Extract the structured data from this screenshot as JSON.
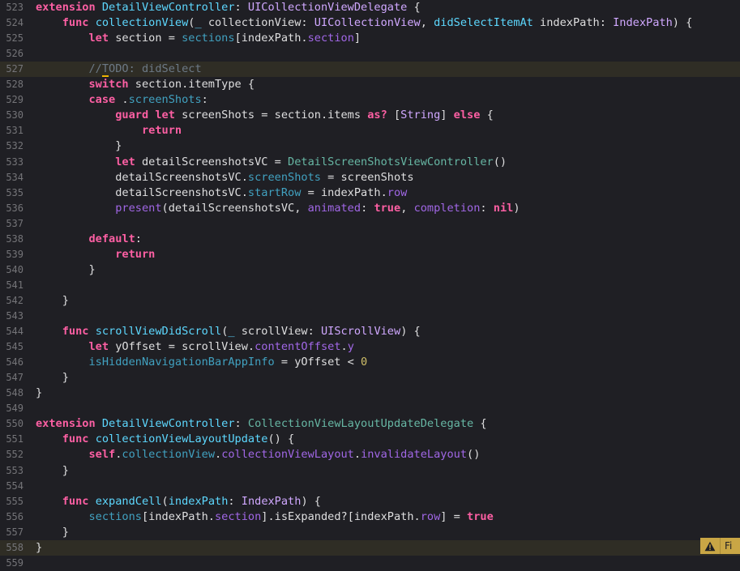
{
  "editor": {
    "highlight_lines": [
      "527",
      "558"
    ],
    "lines": [
      {
        "n": "523",
        "tokens": [
          [
            "kw",
            "extension"
          ],
          [
            "pl",
            " "
          ],
          [
            "pty",
            "DetailViewController"
          ],
          [
            "pl",
            ": "
          ],
          [
            "ty",
            "UICollectionViewDelegate"
          ],
          [
            "pl",
            " {"
          ]
        ]
      },
      {
        "n": "524",
        "tokens": [
          [
            "pl",
            "    "
          ],
          [
            "kw",
            "func"
          ],
          [
            "pl",
            " "
          ],
          [
            "pty",
            "collectionView"
          ],
          [
            "pl",
            "("
          ],
          [
            "pty",
            "_"
          ],
          [
            "pl",
            " collectionView: "
          ],
          [
            "ty",
            "UICollectionView"
          ],
          [
            "pl",
            ", "
          ],
          [
            "pty",
            "didSelectItemAt"
          ],
          [
            "pl",
            " indexPath: "
          ],
          [
            "ty",
            "IndexPath"
          ],
          [
            "pl",
            ") {"
          ]
        ]
      },
      {
        "n": "525",
        "tokens": [
          [
            "pl",
            "        "
          ],
          [
            "kw",
            "let"
          ],
          [
            "pl",
            " section = "
          ],
          [
            "proj",
            "sections"
          ],
          [
            "pl",
            "[indexPath."
          ],
          [
            "pf",
            "section"
          ],
          [
            "pl",
            "]"
          ]
        ]
      },
      {
        "n": "526",
        "tokens": []
      },
      {
        "n": "527",
        "tokens": [
          [
            "pl",
            "        "
          ],
          [
            "cm",
            "//"
          ],
          [
            "cm_warn",
            "T"
          ],
          [
            "cm",
            "ODO: didSelect"
          ]
        ]
      },
      {
        "n": "528",
        "tokens": [
          [
            "pl",
            "        "
          ],
          [
            "kw",
            "switch"
          ],
          [
            "pl",
            " section.itemType {"
          ]
        ]
      },
      {
        "n": "529",
        "tokens": [
          [
            "pl",
            "        "
          ],
          [
            "kw",
            "case"
          ],
          [
            "pl",
            " ."
          ],
          [
            "proj",
            "screenShots"
          ],
          [
            "pl",
            ":"
          ]
        ]
      },
      {
        "n": "530",
        "tokens": [
          [
            "pl",
            "            "
          ],
          [
            "kw",
            "guard"
          ],
          [
            "pl",
            " "
          ],
          [
            "kw",
            "let"
          ],
          [
            "pl",
            " screenShots = section.items "
          ],
          [
            "kw",
            "as?"
          ],
          [
            "pl",
            " ["
          ],
          [
            "ty",
            "String"
          ],
          [
            "pl",
            "] "
          ],
          [
            "kw",
            "else"
          ],
          [
            "pl",
            " {"
          ]
        ]
      },
      {
        "n": "531",
        "tokens": [
          [
            "pl",
            "                "
          ],
          [
            "kw",
            "return"
          ]
        ]
      },
      {
        "n": "532",
        "tokens": [
          [
            "pl",
            "            }"
          ]
        ]
      },
      {
        "n": "533",
        "tokens": [
          [
            "pl",
            "            "
          ],
          [
            "kw",
            "let"
          ],
          [
            "pl",
            " detailScreenshotsVC = "
          ],
          [
            "pm",
            "DetailScreenShotsViewController"
          ],
          [
            "pl",
            "()"
          ]
        ]
      },
      {
        "n": "534",
        "tokens": [
          [
            "pl",
            "            detailScreenshotsVC."
          ],
          [
            "proj",
            "screenShots"
          ],
          [
            "pl",
            " = screenShots"
          ]
        ]
      },
      {
        "n": "535",
        "tokens": [
          [
            "pl",
            "            detailScreenshotsVC."
          ],
          [
            "proj",
            "startRow"
          ],
          [
            "pl",
            " = indexPath."
          ],
          [
            "pf",
            "row"
          ]
        ]
      },
      {
        "n": "536",
        "tokens": [
          [
            "pl",
            "            "
          ],
          [
            "pf",
            "present"
          ],
          [
            "pl",
            "(detailScreenshotsVC, "
          ],
          [
            "pf",
            "animated"
          ],
          [
            "pl",
            ": "
          ],
          [
            "kw",
            "true"
          ],
          [
            "pl",
            ", "
          ],
          [
            "pf",
            "completion"
          ],
          [
            "pl",
            ": "
          ],
          [
            "kw",
            "nil"
          ],
          [
            "pl",
            ")"
          ]
        ]
      },
      {
        "n": "537",
        "tokens": []
      },
      {
        "n": "538",
        "tokens": [
          [
            "pl",
            "        "
          ],
          [
            "kw",
            "default"
          ],
          [
            "pl",
            ":"
          ]
        ]
      },
      {
        "n": "539",
        "tokens": [
          [
            "pl",
            "            "
          ],
          [
            "kw",
            "return"
          ]
        ]
      },
      {
        "n": "540",
        "tokens": [
          [
            "pl",
            "        }"
          ]
        ]
      },
      {
        "n": "541",
        "tokens": []
      },
      {
        "n": "542",
        "tokens": [
          [
            "pl",
            "    }"
          ]
        ]
      },
      {
        "n": "543",
        "tokens": []
      },
      {
        "n": "544",
        "tokens": [
          [
            "pl",
            "    "
          ],
          [
            "kw",
            "func"
          ],
          [
            "pl",
            " "
          ],
          [
            "pty",
            "scrollViewDidScroll"
          ],
          [
            "pl",
            "("
          ],
          [
            "pty",
            "_"
          ],
          [
            "pl",
            " scrollView: "
          ],
          [
            "ty",
            "UIScrollView"
          ],
          [
            "pl",
            ") {"
          ]
        ]
      },
      {
        "n": "545",
        "tokens": [
          [
            "pl",
            "        "
          ],
          [
            "kw",
            "let"
          ],
          [
            "pl",
            " yOffset = scrollView."
          ],
          [
            "pf",
            "contentOffset"
          ],
          [
            "pl",
            "."
          ],
          [
            "pf",
            "y"
          ]
        ]
      },
      {
        "n": "546",
        "tokens": [
          [
            "pl",
            "        "
          ],
          [
            "proj",
            "isHiddenNavigationBarAppInfo"
          ],
          [
            "pl",
            " = yOffset < "
          ],
          [
            "num",
            "0"
          ]
        ]
      },
      {
        "n": "547",
        "tokens": [
          [
            "pl",
            "    }"
          ]
        ]
      },
      {
        "n": "548",
        "tokens": [
          [
            "pl",
            "}"
          ]
        ]
      },
      {
        "n": "549",
        "tokens": []
      },
      {
        "n": "550",
        "tokens": [
          [
            "kw",
            "extension"
          ],
          [
            "pl",
            " "
          ],
          [
            "pty",
            "DetailViewController"
          ],
          [
            "pl",
            ": "
          ],
          [
            "pm",
            "CollectionViewLayoutUpdateDelegate"
          ],
          [
            "pl",
            " {"
          ]
        ]
      },
      {
        "n": "551",
        "tokens": [
          [
            "pl",
            "    "
          ],
          [
            "kw",
            "func"
          ],
          [
            "pl",
            " "
          ],
          [
            "pty",
            "collectionViewLayoutUpdate"
          ],
          [
            "pl",
            "() {"
          ]
        ]
      },
      {
        "n": "552",
        "tokens": [
          [
            "pl",
            "        "
          ],
          [
            "kw",
            "self"
          ],
          [
            "pl",
            "."
          ],
          [
            "proj",
            "collectionView"
          ],
          [
            "pl",
            "."
          ],
          [
            "pf",
            "collectionViewLayout"
          ],
          [
            "pl",
            "."
          ],
          [
            "pf",
            "invalidateLayout"
          ],
          [
            "pl",
            "()"
          ]
        ]
      },
      {
        "n": "553",
        "tokens": [
          [
            "pl",
            "    }"
          ]
        ]
      },
      {
        "n": "554",
        "tokens": []
      },
      {
        "n": "555",
        "tokens": [
          [
            "pl",
            "    "
          ],
          [
            "kw",
            "func"
          ],
          [
            "pl",
            " "
          ],
          [
            "pty",
            "expandCell"
          ],
          [
            "pl",
            "("
          ],
          [
            "pty",
            "indexPath"
          ],
          [
            "pl",
            ": "
          ],
          [
            "ty",
            "IndexPath"
          ],
          [
            "pl",
            ") {"
          ]
        ]
      },
      {
        "n": "556",
        "tokens": [
          [
            "pl",
            "        "
          ],
          [
            "proj",
            "sections"
          ],
          [
            "pl",
            "[indexPath."
          ],
          [
            "pf",
            "section"
          ],
          [
            "pl",
            "].isExpanded?[indexPath."
          ],
          [
            "pf",
            "row"
          ],
          [
            "pl",
            "] = "
          ],
          [
            "kw",
            "true"
          ]
        ]
      },
      {
        "n": "557",
        "tokens": [
          [
            "pl",
            "    }"
          ]
        ]
      },
      {
        "n": "558",
        "tokens": [
          [
            "pl",
            "}"
          ]
        ]
      },
      {
        "n": "559",
        "tokens": []
      }
    ]
  },
  "issue_badge": {
    "icon": "warning-triangle-icon",
    "label": "Fi",
    "color": "#c9a645"
  },
  "colors": {
    "background": "#1f1f24",
    "current_line": "#2f2d25",
    "keyword": "#fc5fa3",
    "type": "#d0a8ff",
    "declaration": "#5dd8ff",
    "project_symbol": "#41a1c0",
    "framework_function": "#a167e6",
    "comment": "#6c7986",
    "number": "#d0bf69"
  }
}
